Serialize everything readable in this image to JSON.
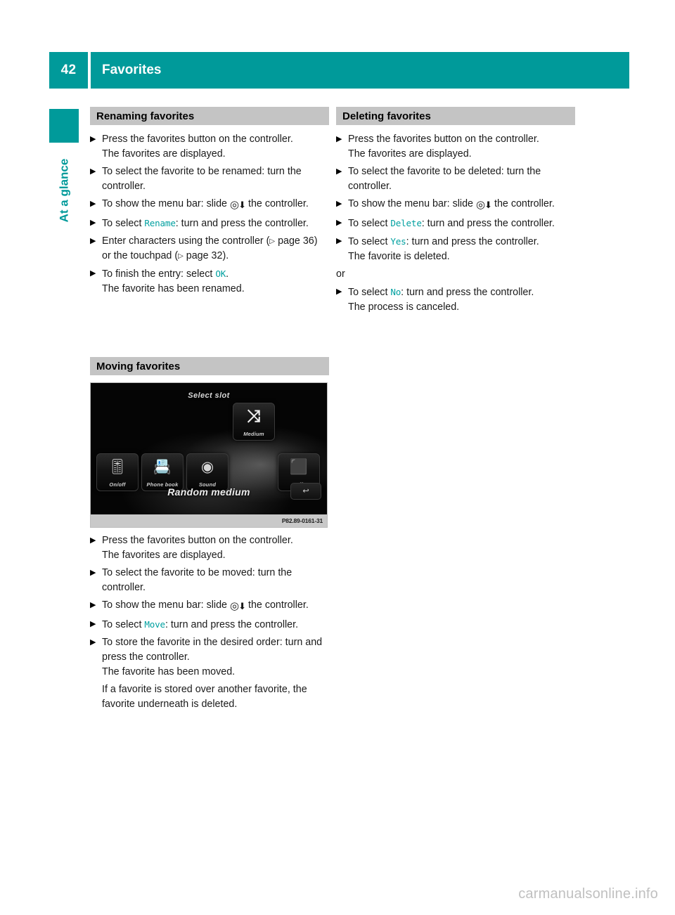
{
  "header": {
    "page_number": "42",
    "title": "Favorites",
    "accent_color": "#009a9a"
  },
  "chapter_tab": {
    "label": "At a glance",
    "color": "#009a9a"
  },
  "section_bar_color": "#c4c4c4",
  "menu_term_color": "#00a0a0",
  "icons": {
    "bullet": "▶",
    "page_ref": "▷",
    "controller_ring": "◎",
    "controller_arrow": "⬇",
    "shuffle": "⤨",
    "back_arrow": "↩"
  },
  "sections": {
    "renaming": {
      "heading": "Renaming favorites",
      "steps": [
        {
          "parts": [
            {
              "t": "text",
              "v": "Press the favorites button on the controller."
            }
          ],
          "follow": "The favorites are displayed."
        },
        {
          "parts": [
            {
              "t": "text",
              "v": "To select the favorite to be renamed: turn the controller."
            }
          ],
          "follow": ""
        },
        {
          "parts": [
            {
              "t": "text",
              "v": "To show the menu bar: slide "
            },
            {
              "t": "ctrl",
              "v": "controller-slide-down"
            },
            {
              "t": "text",
              "v": " the controller."
            }
          ],
          "follow": ""
        },
        {
          "parts": [
            {
              "t": "text",
              "v": "To select "
            },
            {
              "t": "menu",
              "v": "Rename"
            },
            {
              "t": "text",
              "v": ": turn and press the controller."
            }
          ],
          "follow": ""
        },
        {
          "parts": [
            {
              "t": "text",
              "v": "Enter characters using the controller ("
            },
            {
              "t": "ref",
              "v": "page 36"
            },
            {
              "t": "text",
              "v": ") or the touchpad ("
            },
            {
              "t": "ref",
              "v": "page 32"
            },
            {
              "t": "text",
              "v": ")."
            }
          ],
          "follow": ""
        },
        {
          "parts": [
            {
              "t": "text",
              "v": "To finish the entry: select "
            },
            {
              "t": "menu",
              "v": "OK"
            },
            {
              "t": "text",
              "v": "."
            }
          ],
          "follow": "The favorite has been renamed."
        }
      ]
    },
    "deleting": {
      "heading": "Deleting favorites",
      "or_label": "or",
      "steps": [
        {
          "parts": [
            {
              "t": "text",
              "v": "Press the favorites button on the controller."
            }
          ],
          "follow": "The favorites are displayed."
        },
        {
          "parts": [
            {
              "t": "text",
              "v": "To select the favorite to be deleted: turn the controller."
            }
          ],
          "follow": ""
        },
        {
          "parts": [
            {
              "t": "text",
              "v": "To show the menu bar: slide "
            },
            {
              "t": "ctrl",
              "v": "controller-slide-down"
            },
            {
              "t": "text",
              "v": " the controller."
            }
          ],
          "follow": ""
        },
        {
          "parts": [
            {
              "t": "text",
              "v": "To select "
            },
            {
              "t": "menu",
              "v": "Delete"
            },
            {
              "t": "text",
              "v": ": turn and press the controller."
            }
          ],
          "follow": ""
        },
        {
          "parts": [
            {
              "t": "text",
              "v": "To select "
            },
            {
              "t": "menu",
              "v": "Yes"
            },
            {
              "t": "text",
              "v": ": turn and press the controller."
            }
          ],
          "follow": "The favorite is deleted."
        }
      ],
      "steps_after_or": [
        {
          "parts": [
            {
              "t": "text",
              "v": "To select "
            },
            {
              "t": "menu",
              "v": "No"
            },
            {
              "t": "text",
              "v": ": turn and press the controller."
            }
          ],
          "follow": "The process is canceled."
        }
      ]
    },
    "moving": {
      "heading": "Moving favorites",
      "figure": {
        "title": "Select slot",
        "caption": "Random medium",
        "code": "P82.89-0161-31",
        "slot_tile_label": "Medium",
        "tiles": [
          {
            "label": "On/off",
            "icon": "🎚"
          },
          {
            "label": "Phone book",
            "icon": "📇"
          },
          {
            "label": "Sound",
            "icon": "◉"
          },
          {
            "label": "Off",
            "icon": "⬛"
          }
        ]
      },
      "steps": [
        {
          "parts": [
            {
              "t": "text",
              "v": "Press the favorites button on the controller."
            }
          ],
          "follow": "The favorites are displayed."
        },
        {
          "parts": [
            {
              "t": "text",
              "v": "To select the favorite to be moved: turn the controller."
            }
          ],
          "follow": ""
        },
        {
          "parts": [
            {
              "t": "text",
              "v": "To show the menu bar: slide "
            },
            {
              "t": "ctrl",
              "v": "controller-slide-down"
            },
            {
              "t": "text",
              "v": " the controller."
            }
          ],
          "follow": ""
        },
        {
          "parts": [
            {
              "t": "text",
              "v": "To select "
            },
            {
              "t": "menu",
              "v": "Move"
            },
            {
              "t": "text",
              "v": ": turn and press the controller."
            }
          ],
          "follow": ""
        },
        {
          "parts": [
            {
              "t": "text",
              "v": "To store the favorite in the desired order: turn and press the controller."
            }
          ],
          "follow": "The favorite has been moved."
        }
      ],
      "note": "If a favorite is stored over another favorite, the favorite underneath is deleted."
    }
  },
  "watermark": "carmanualsonline.info"
}
